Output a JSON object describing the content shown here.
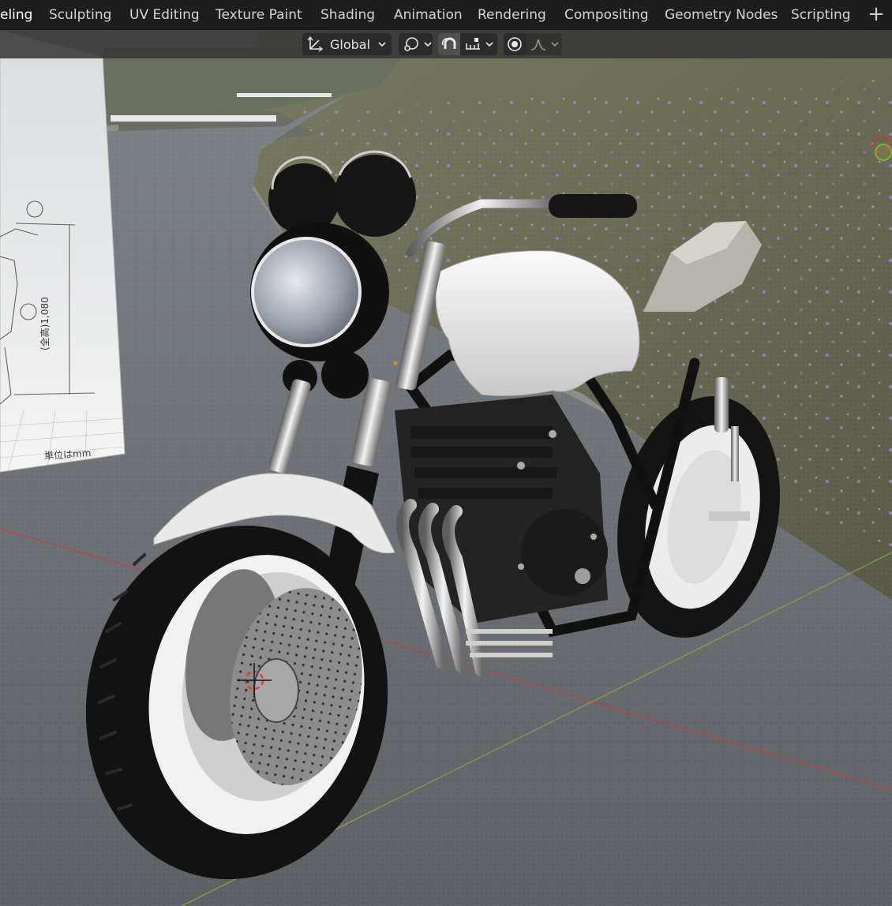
{
  "workspace_tabs": [
    {
      "label": "eling"
    },
    {
      "label": "Sculpting"
    },
    {
      "label": "UV Editing"
    },
    {
      "label": "Texture Paint"
    },
    {
      "label": "Shading"
    },
    {
      "label": "Animation"
    },
    {
      "label": "Rendering"
    },
    {
      "label": "Compositing"
    },
    {
      "label": "Geometry Nodes"
    },
    {
      "label": "Scripting"
    }
  ],
  "add_workspace_label": "+",
  "viewport_header": {
    "transform_orientation": "Global",
    "pivot_icon": "pivot-point-icon",
    "snap_icon": "magnet-snap-icon",
    "snap_target_icon": "snap-increment-icon",
    "proportional_edit_icon": "proportional-edit-icon",
    "falloff_icon": "falloff-curve-icon",
    "snap_enabled": true
  },
  "reference_image": {
    "height_label": "(全高)1,080",
    "unit_label": "単位はmm"
  },
  "colors": {
    "header_bg": "#373737",
    "tab_text": "#d4d4d4",
    "active_toggle": "#505050",
    "x_axis": "#c0413f",
    "y_axis": "#84a83a"
  }
}
